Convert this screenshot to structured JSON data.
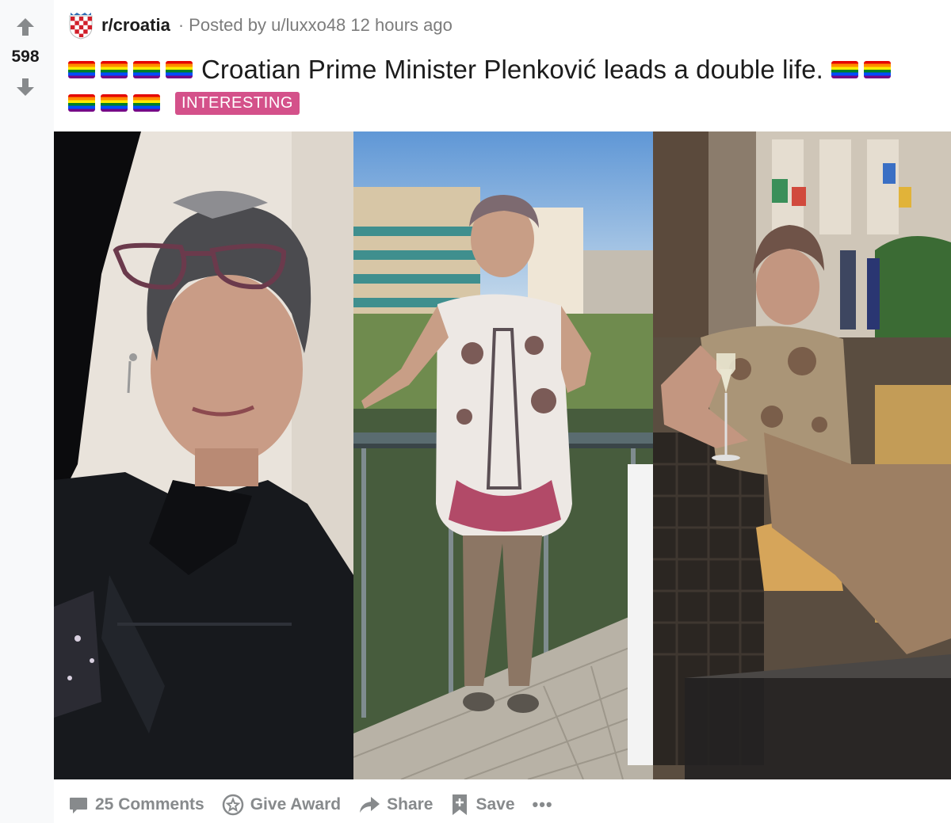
{
  "vote": {
    "score": "598"
  },
  "post": {
    "subreddit": "r/croatia",
    "separator": "·",
    "posted_by": "Posted by u/luxxo48",
    "time_ago": "12 hours ago",
    "title": "Croatian Prime Minister Plenković leads a double life.",
    "flair": "INTERESTING",
    "flair_color": "#d4518a",
    "leading_flag_count": 4,
    "trailing_flag_count": 2,
    "second_line_flag_count": 3,
    "flag_icon": "rainbow-flag-emoji"
  },
  "actions": {
    "comments": "25 Comments",
    "award": "Give Award",
    "share": "Share",
    "save": "Save",
    "more": "•••"
  },
  "icons": {
    "upvote": "arrow-up-icon",
    "downvote": "arrow-down-icon",
    "comments": "comment-bubble-icon",
    "award": "award-star-icon",
    "share": "share-arrow-icon",
    "save": "bookmark-plus-icon"
  },
  "colors": {
    "rail_bg": "#f8f9fa",
    "muted_text": "#878a8c",
    "meta_text": "#7c7c7c"
  }
}
